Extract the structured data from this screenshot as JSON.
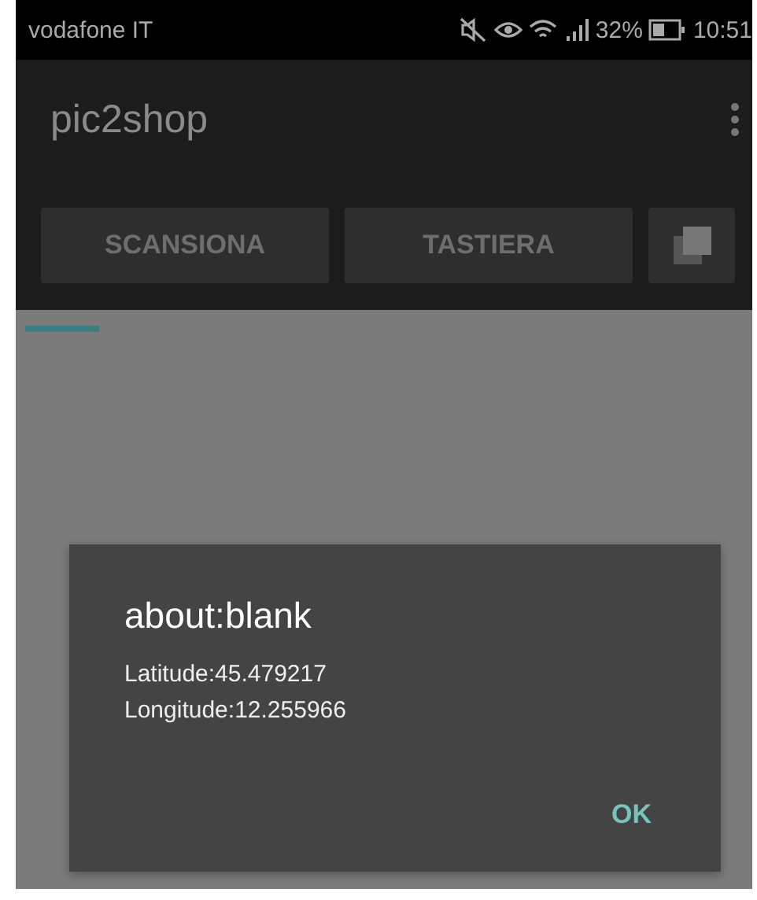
{
  "status_bar": {
    "carrier": "vodafone IT",
    "battery": "32%",
    "time": "10:51"
  },
  "app_bar": {
    "title": "pic2shop"
  },
  "buttons": [
    {
      "kind": "text",
      "label": "SCANSIONA"
    },
    {
      "kind": "text",
      "label": "TASTIERA"
    },
    {
      "kind": "icon"
    }
  ],
  "dialog": {
    "title": "about:blank",
    "lines": [
      "Latitude:45.479217",
      "Longitude:12.255966"
    ],
    "button": "OK"
  }
}
